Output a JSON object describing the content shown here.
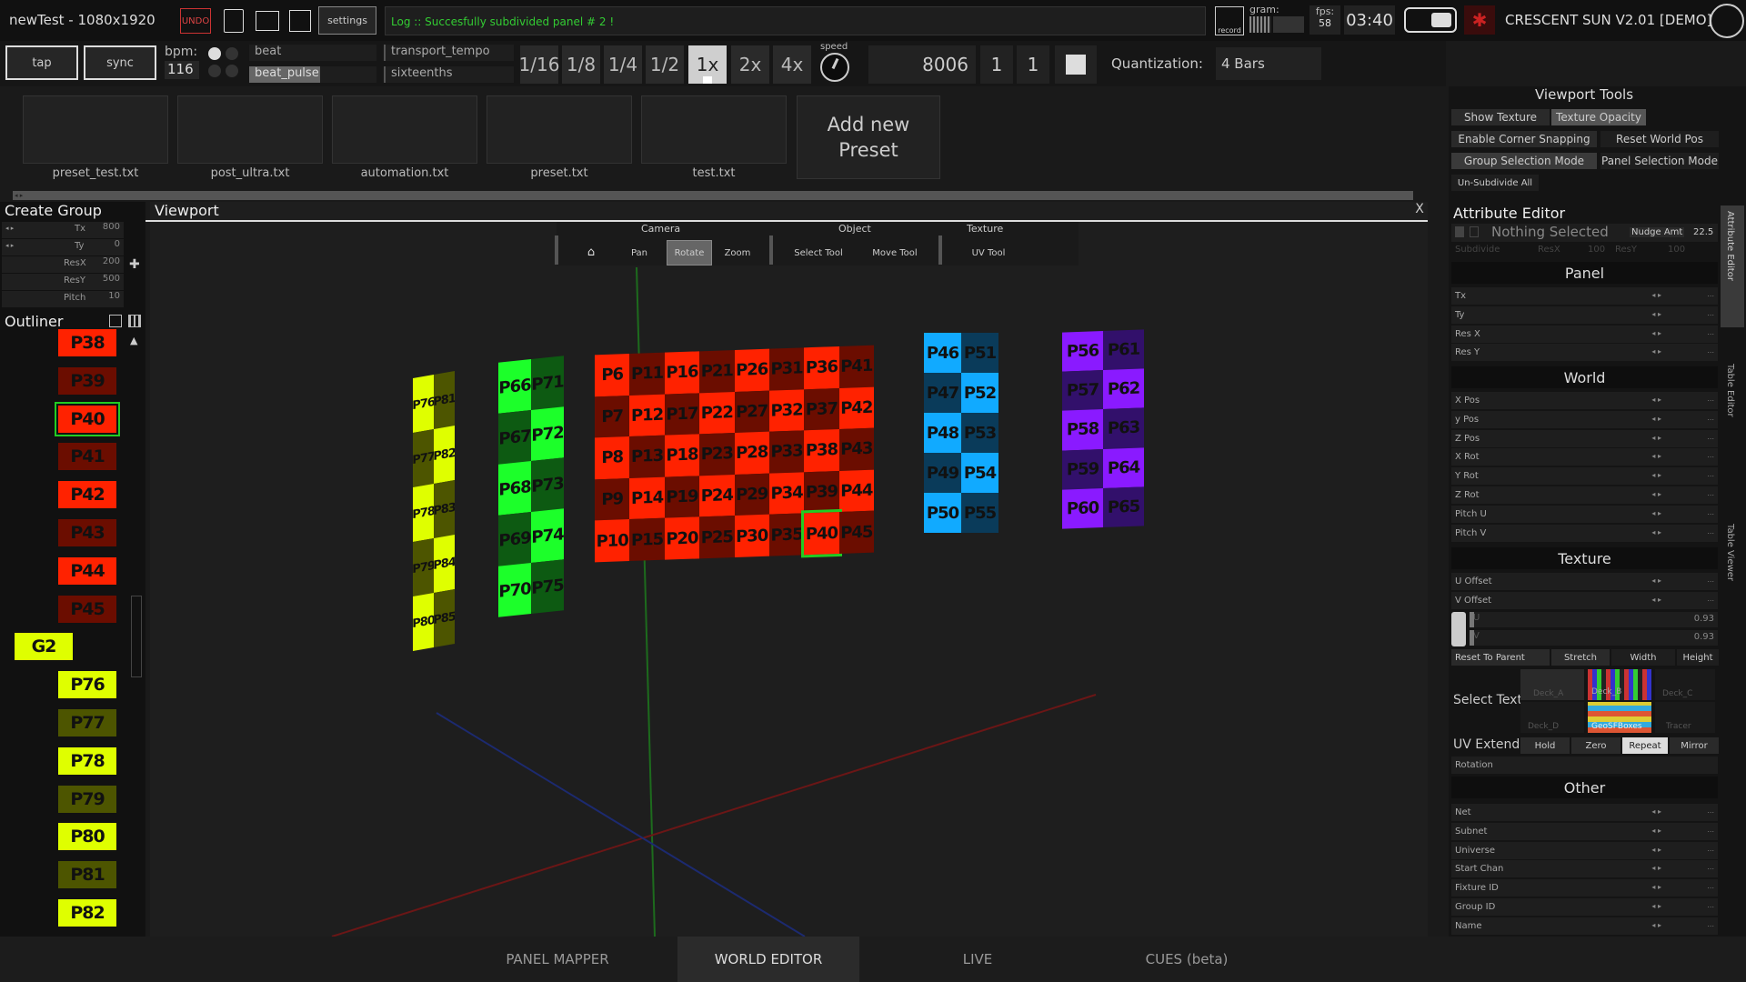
{
  "top": {
    "title": "newTest - 1080x1920",
    "undo": "UNDO",
    "settings": "settings",
    "log": "Log :: Succesfully subdivided panel # 2 !",
    "record": "record",
    "gram": "gram:",
    "fps_label": "fps:",
    "fps": "58",
    "time": "03:40",
    "app": "CRESCENT SUN V2.01 [DEMO]"
  },
  "transport": {
    "tap": "tap",
    "sync": "sync",
    "bpm_label": "bpm:",
    "bpm": "116",
    "beat": "beat",
    "beat_pulse": "beat_pulse",
    "transport_tempo": "transport_tempo",
    "sixteenths": "sixteenths",
    "divisions": [
      "1/16",
      "1/8",
      "1/4",
      "1/2",
      "1x",
      "2x",
      "4x"
    ],
    "speed": "speed",
    "counter": "8006",
    "c1": "1",
    "c2": "1",
    "quant_label": "Quantization:",
    "quant_value": "4 Bars"
  },
  "presets": {
    "files": [
      "preset_test.txt",
      "post_ultra.txt",
      "automation.txt",
      "preset.txt",
      "test.txt"
    ],
    "add": "Add new\nPreset"
  },
  "left": {
    "create_group": "Create Group",
    "fields": [
      {
        "label": "Tx",
        "value": "800"
      },
      {
        "label": "Ty",
        "value": "0"
      },
      {
        "label": "ResX",
        "value": "200"
      },
      {
        "label": "ResY",
        "value": "500"
      },
      {
        "label": "Pitch",
        "value": "10"
      }
    ],
    "outliner": "Outliner",
    "items": [
      {
        "label": "P38",
        "color": "#ff2200"
      },
      {
        "label": "P39",
        "color": "#6b0d00"
      },
      {
        "label": "P40",
        "color": "#ff2200",
        "selected": true
      },
      {
        "label": "P41",
        "color": "#6b0d00"
      },
      {
        "label": "P42",
        "color": "#ff2200"
      },
      {
        "label": "P43",
        "color": "#6b0d00"
      },
      {
        "label": "P44",
        "color": "#ff2200"
      },
      {
        "label": "P45",
        "color": "#6b0d00"
      },
      {
        "label": "G2",
        "color": "#dfff00",
        "group": true
      },
      {
        "label": "P76",
        "color": "#dfff00"
      },
      {
        "label": "P77",
        "color": "#4d5500"
      },
      {
        "label": "P78",
        "color": "#dfff00"
      },
      {
        "label": "P79",
        "color": "#4d5500"
      },
      {
        "label": "P80",
        "color": "#dfff00"
      },
      {
        "label": "P81",
        "color": "#4d5500"
      },
      {
        "label": "P82",
        "color": "#dfff00"
      }
    ]
  },
  "viewport": {
    "title": "Viewport",
    "close": "X",
    "camera": "Camera",
    "object": "Object",
    "texture": "Texture",
    "tools": [
      "Pan",
      "Rotate",
      "Zoom",
      "Select Tool",
      "Move Tool",
      "UV Tool"
    ]
  },
  "panels": {
    "yellow": {
      "cols": 2,
      "rows": 5,
      "labels": [
        "P76",
        "P81",
        "P77",
        "P82",
        "P78",
        "P83",
        "P79",
        "P84",
        "P80",
        "P85"
      ],
      "a": "#dfff00",
      "b": "#4d5500"
    },
    "green": {
      "cols": 2,
      "rows": 5,
      "labels": [
        "P66",
        "P71",
        "P67",
        "P72",
        "P68",
        "P73",
        "P69",
        "P74",
        "P70",
        "P75"
      ],
      "a": "#1cff2a",
      "b": "#0d5a12"
    },
    "red": {
      "cols": 8,
      "rows": 5,
      "labels": [
        "P6",
        "P11",
        "P16",
        "P21",
        "P26",
        "P31",
        "P36",
        "P41",
        "P7",
        "P12",
        "P17",
        "P22",
        "P27",
        "P32",
        "P37",
        "P42",
        "P8",
        "P13",
        "P18",
        "P23",
        "P28",
        "P33",
        "P38",
        "P43",
        "P9",
        "P14",
        "P19",
        "P24",
        "P29",
        "P34",
        "P39",
        "P44",
        "P10",
        "P15",
        "P20",
        "P25",
        "P30",
        "P35",
        "P40",
        "P45"
      ],
      "a": "#ff2200",
      "b": "#6b0d00"
    },
    "blue": {
      "cols": 2,
      "rows": 5,
      "labels": [
        "P46",
        "P51",
        "P47",
        "P52",
        "P48",
        "P53",
        "P49",
        "P54",
        "P50",
        "P55"
      ],
      "a": "#11aaff",
      "b": "#0a3b5a"
    },
    "purple": {
      "cols": 2,
      "rows": 5,
      "labels": [
        "P56",
        "P61",
        "P57",
        "P62",
        "P58",
        "P63",
        "P59",
        "P64",
        "P60",
        "P65"
      ],
      "a": "#8a1aff",
      "b": "#32106b"
    }
  },
  "right": {
    "viewport_tools": "Viewport Tools",
    "vt_buttons": [
      "Show Texture",
      "Texture Opacity",
      "Enable Corner Snapping",
      "Reset World Pos",
      "Group Selection Mode",
      "Panel Selection Mode",
      "Un-Subdivide All"
    ],
    "attr_editor": "Attribute Editor",
    "nothing_selected": "Nothing Selected",
    "nudge": "Nudge Amt",
    "nudge_val": "22.5",
    "subdivide": "Subdivide",
    "resx": "ResX",
    "resx_val": "100",
    "resy": "ResY",
    "resy_val": "100",
    "panel": "Panel",
    "panel_fields": [
      "Tx",
      "Ty",
      "Res X",
      "Res Y"
    ],
    "world": "World",
    "world_fields": [
      "X Pos",
      "y Pos",
      "Z Pos",
      "X Rot",
      "Y Rot",
      "Z Rot",
      "Pitch U",
      "Pitch V"
    ],
    "texture": "Texture",
    "texture_fields": [
      "U Offset",
      "V Offset"
    ],
    "u": "U",
    "v": "V",
    "u_val": "0.93",
    "v_val": "0.93",
    "reset_parent": "Reset To Parent",
    "stretch": "Stretch",
    "width": "Width",
    "height": "Height",
    "select_text": "Select Text",
    "decks": [
      "Deck_A",
      "Deck_B",
      "Deck_C",
      "Deck_D",
      "GeoSFBoxes",
      "Tracer"
    ],
    "uv_extend": "UV Extend",
    "uv_modes": [
      "Hold",
      "Zero",
      "Repeat",
      "Mirror"
    ],
    "rotation": "Rotation",
    "other": "Other",
    "other_fields": [
      "Net",
      "Subnet",
      "Universe",
      "Start Chan",
      "Fixture ID",
      "Group ID",
      "Name"
    ],
    "side_tabs": [
      "Attribute Editor",
      "Table Editor",
      "Table Viewer"
    ],
    "dots": "..."
  },
  "tabs": [
    "PANEL MAPPER",
    "WORLD EDITOR",
    "LIVE",
    "CUES (beta)"
  ]
}
